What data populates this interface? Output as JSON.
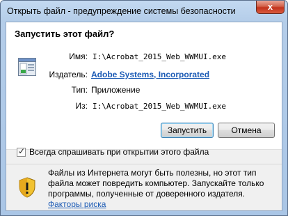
{
  "window": {
    "title": "Открыть файл - предупреждение системы безопасности",
    "close_glyph": "x"
  },
  "dialog": {
    "heading": "Запустить этот файл?",
    "fields": {
      "name_label": "Имя:",
      "name_value": "I:\\Acrobat_2015_Web_WWMUI.exe",
      "publisher_label": "Издатель:",
      "publisher_value": "Adobe Systems, Incorporated",
      "type_label": "Тип:",
      "type_value": "Приложение",
      "from_label": "Из:",
      "from_value": "I:\\Acrobat_2015_Web_WWMUI.exe"
    },
    "buttons": {
      "run": "Запустить",
      "cancel": "Отмена"
    },
    "checkbox": {
      "label": "Всегда спрашивать при открытии этого файла",
      "checked": true
    },
    "warning": {
      "text": "Файлы из Интернета могут быть полезны, но этот тип файла может повредить компьютер. Запускайте только программы, полученные от доверенного издателя.",
      "link": "Факторы риска"
    }
  },
  "colors": {
    "link": "#1c5bb5",
    "shield_yellow": "#f2c230",
    "shield_dark": "#b8860b"
  },
  "icons": [
    "close-icon",
    "application-file-icon",
    "checkmark-icon",
    "warning-shield-icon"
  ]
}
